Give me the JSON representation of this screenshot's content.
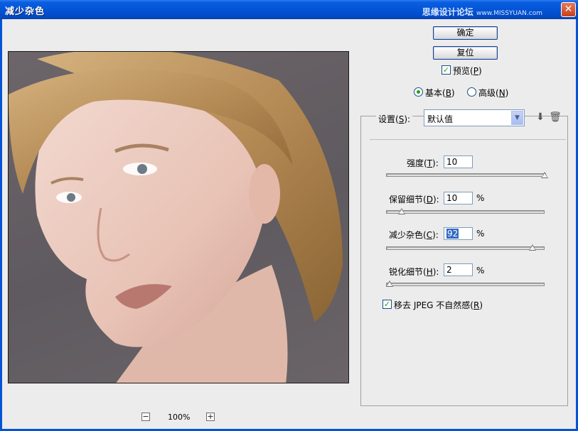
{
  "window": {
    "title": "减少杂色",
    "watermark": "思缘设计论坛",
    "watermark_url": "www.MISSYUAN.com"
  },
  "buttons": {
    "ok": "确定",
    "reset": "复位"
  },
  "preview_option": {
    "checked": true,
    "label_prefix": "预览(",
    "accel": "P",
    "label_suffix": ")"
  },
  "mode": {
    "options": [
      {
        "prefix": "基本(",
        "accel": "B",
        "suffix": ")",
        "selected": true
      },
      {
        "prefix": "高级(",
        "accel": "N",
        "suffix": ")",
        "selected": false
      }
    ]
  },
  "settings": {
    "label_prefix": "设置(",
    "accel": "S",
    "label_suffix": "):",
    "selected_value": "默认值"
  },
  "params": [
    {
      "prefix": "强度(",
      "accel": "T",
      "suffix": "):",
      "value": "10",
      "unit": "",
      "slider_fraction": 1.0
    },
    {
      "prefix": "保留细节(",
      "accel": "D",
      "suffix": "):",
      "value": "10",
      "unit": "%",
      "slider_fraction": 0.1
    },
    {
      "prefix": "减少杂色(",
      "accel": "C",
      "suffix": "):",
      "value": "92",
      "unit": "%",
      "slider_fraction": 0.92
    },
    {
      "prefix": "锐化细节(",
      "accel": "H",
      "suffix": "):",
      "value": "2",
      "unit": "%",
      "slider_fraction": 0.02
    }
  ],
  "jpeg_option": {
    "checked": true,
    "label_prefix": "移去 JPEG 不自然感(",
    "accel": "R",
    "label_suffix": ")"
  },
  "zoom": {
    "minus": "−",
    "value": "100%",
    "plus": "+"
  },
  "colors": {
    "titlebar": "#0454d6",
    "dialog_bg": "#ececec",
    "selection": "#316ac5"
  }
}
